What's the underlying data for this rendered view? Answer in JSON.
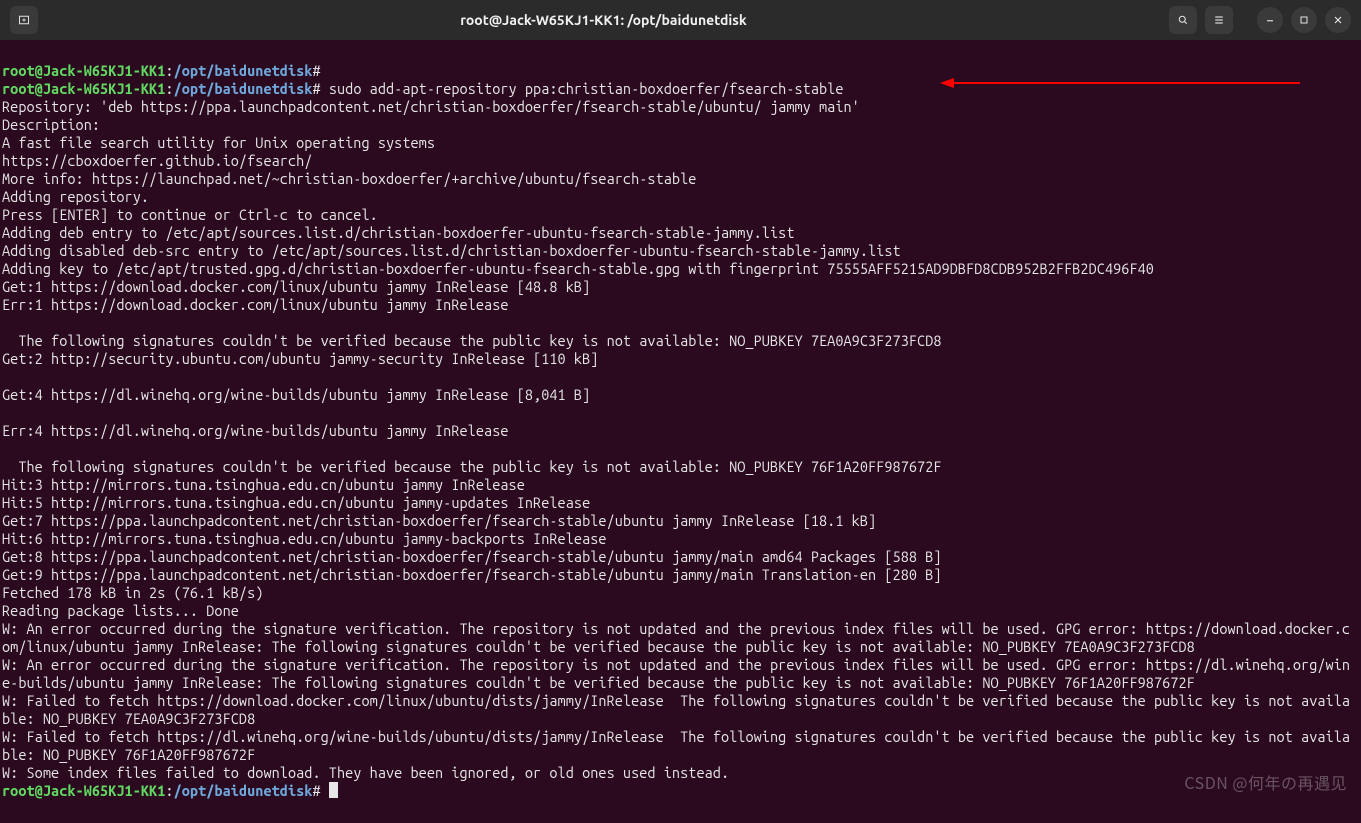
{
  "title": "root@Jack-W65KJ1-KK1: /opt/baidunetdisk",
  "prompt": {
    "user_host": "root@Jack-W65KJ1-KK1",
    "sep": ":",
    "path": "/opt/baidunetdisk",
    "hash": "#"
  },
  "command": "sudo add-apt-repository ppa:christian-boxdoerfer/fsearch-stable",
  "output_lines": [
    "Repository: 'deb https://ppa.launchpadcontent.net/christian-boxdoerfer/fsearch-stable/ubuntu/ jammy main'",
    "Description:",
    "A fast file search utility for Unix operating systems",
    "https://cboxdoerfer.github.io/fsearch/",
    "More info: https://launchpad.net/~christian-boxdoerfer/+archive/ubuntu/fsearch-stable",
    "Adding repository.",
    "Press [ENTER] to continue or Ctrl-c to cancel.",
    "Adding deb entry to /etc/apt/sources.list.d/christian-boxdoerfer-ubuntu-fsearch-stable-jammy.list",
    "Adding disabled deb-src entry to /etc/apt/sources.list.d/christian-boxdoerfer-ubuntu-fsearch-stable-jammy.list",
    "Adding key to /etc/apt/trusted.gpg.d/christian-boxdoerfer-ubuntu-fsearch-stable.gpg with fingerprint 75555AFF5215AD9DBFD8CDB952B2FFB2DC496F40",
    "Get:1 https://download.docker.com/linux/ubuntu jammy InRelease [48.8 kB]",
    "Err:1 https://download.docker.com/linux/ubuntu jammy InRelease",
    "",
    "  The following signatures couldn't be verified because the public key is not available: NO_PUBKEY 7EA0A9C3F273FCD8",
    "Get:2 http://security.ubuntu.com/ubuntu jammy-security InRelease [110 kB]",
    "",
    "Get:4 https://dl.winehq.org/wine-builds/ubuntu jammy InRelease [8,041 B]",
    "",
    "Err:4 https://dl.winehq.org/wine-builds/ubuntu jammy InRelease",
    "",
    "  The following signatures couldn't be verified because the public key is not available: NO_PUBKEY 76F1A20FF987672F",
    "Hit:3 http://mirrors.tuna.tsinghua.edu.cn/ubuntu jammy InRelease",
    "Hit:5 http://mirrors.tuna.tsinghua.edu.cn/ubuntu jammy-updates InRelease",
    "Get:7 https://ppa.launchpadcontent.net/christian-boxdoerfer/fsearch-stable/ubuntu jammy InRelease [18.1 kB]",
    "Hit:6 http://mirrors.tuna.tsinghua.edu.cn/ubuntu jammy-backports InRelease",
    "Get:8 https://ppa.launchpadcontent.net/christian-boxdoerfer/fsearch-stable/ubuntu jammy/main amd64 Packages [588 B]",
    "Get:9 https://ppa.launchpadcontent.net/christian-boxdoerfer/fsearch-stable/ubuntu jammy/main Translation-en [280 B]",
    "Fetched 178 kB in 2s (76.1 kB/s)",
    "Reading package lists... Done",
    "W: An error occurred during the signature verification. The repository is not updated and the previous index files will be used. GPG error: https://download.docker.com/linux/ubuntu jammy InRelease: The following signatures couldn't be verified because the public key is not available: NO_PUBKEY 7EA0A9C3F273FCD8",
    "W: An error occurred during the signature verification. The repository is not updated and the previous index files will be used. GPG error: https://dl.winehq.org/wine-builds/ubuntu jammy InRelease: The following signatures couldn't be verified because the public key is not available: NO_PUBKEY 76F1A20FF987672F",
    "W: Failed to fetch https://download.docker.com/linux/ubuntu/dists/jammy/InRelease  The following signatures couldn't be verified because the public key is not available: NO_PUBKEY 7EA0A9C3F273FCD8",
    "W: Failed to fetch https://dl.winehq.org/wine-builds/ubuntu/dists/jammy/InRelease  The following signatures couldn't be verified because the public key is not available: NO_PUBKEY 76F1A20FF987672F",
    "W: Some index files failed to download. They have been ignored, or old ones used instead."
  ],
  "watermark": "CSDN @何年の再遇见",
  "arrow_color": "#ff0000"
}
